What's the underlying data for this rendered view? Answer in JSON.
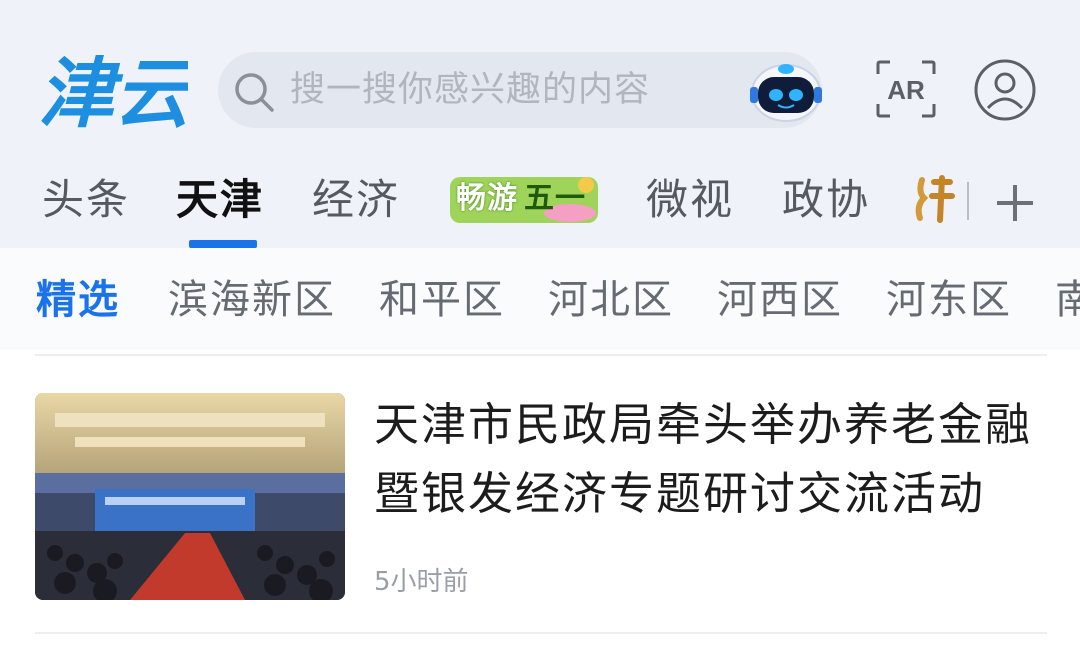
{
  "app": {
    "logo_text": "津云"
  },
  "search": {
    "placeholder": "搜一搜你感兴趣的内容"
  },
  "header": {
    "ar_label": "AR"
  },
  "tabs": [
    {
      "label": "头条",
      "active": false
    },
    {
      "label": "天津",
      "active": true
    },
    {
      "label": "经济",
      "active": false
    },
    {
      "label": "畅游五一",
      "active": false,
      "promo": true
    },
    {
      "label": "微视",
      "active": false
    },
    {
      "label": "政协",
      "active": false
    }
  ],
  "promo": {
    "line_a": "畅游",
    "line_b": "五一"
  },
  "subtabs": [
    {
      "label": "精选",
      "active": true
    },
    {
      "label": "滨海新区"
    },
    {
      "label": "和平区"
    },
    {
      "label": "河北区"
    },
    {
      "label": "河西区"
    },
    {
      "label": "河东区"
    },
    {
      "label": "南"
    }
  ],
  "news": [
    {
      "title": "天津市民政局牵头举办养老金融暨银发经济专题研讨交流活动",
      "time": "5小时前"
    }
  ],
  "colors": {
    "accent": "#1a73e8",
    "logo_blue": "#1e8fe0",
    "promo_green": "#6cbf2a"
  }
}
